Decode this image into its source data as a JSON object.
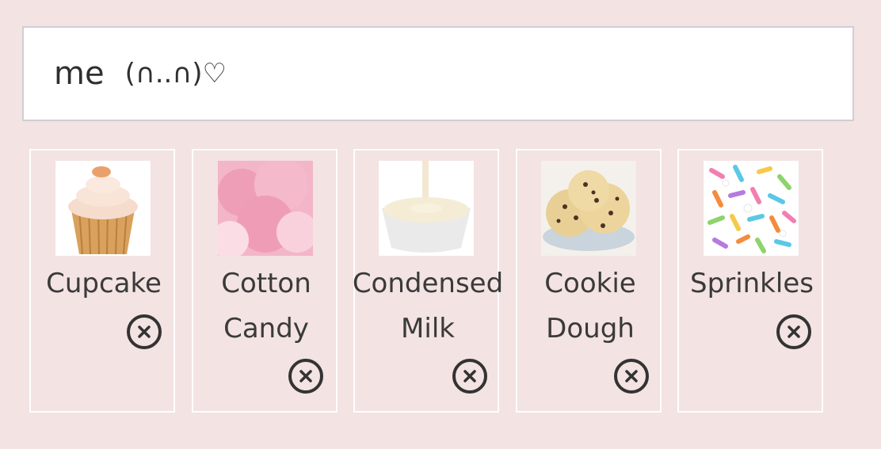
{
  "name_field": {
    "value": "me",
    "emoticon": "(∩..∩)♡"
  },
  "items": [
    {
      "label_lines": [
        "Cupcake"
      ],
      "image": "cupcake-icon"
    },
    {
      "label_lines": [
        "Cotton",
        "Candy"
      ],
      "image": "cotton-candy-icon"
    },
    {
      "label_lines": [
        "Condensed",
        "Milk"
      ],
      "image": "condensed-milk-icon"
    },
    {
      "label_lines": [
        "Cookie",
        "Dough"
      ],
      "image": "cookie-dough-icon"
    },
    {
      "label_lines": [
        "Sprinkles"
      ],
      "image": "sprinkles-icon"
    }
  ],
  "colors": {
    "background": "#f3e3e2",
    "card_border": "#ffffff",
    "text": "#3a3a3a"
  }
}
